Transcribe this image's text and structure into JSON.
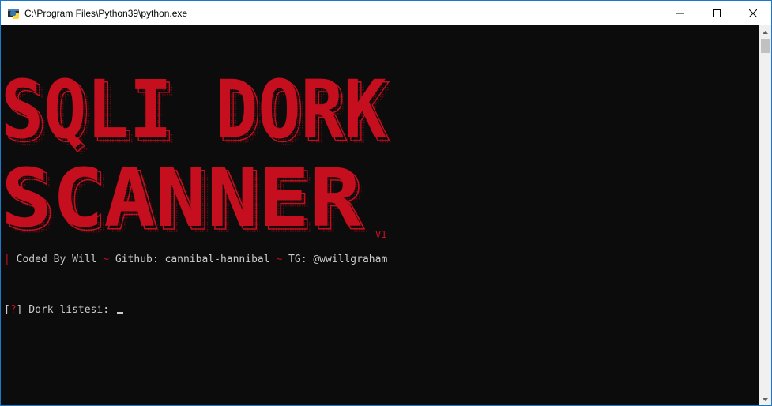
{
  "window": {
    "title": "C:\\Program Files\\Python39\\python.exe",
    "icon": "python-icon",
    "controls": [
      "minimize-icon",
      "maximize-icon",
      "close-icon"
    ]
  },
  "banner": {
    "line1": "SQLI DORK",
    "line2": "SCANNER",
    "version": "V1",
    "color": "#c50f1f"
  },
  "credits": {
    "bar": "|",
    "coded_by": " Coded By Will ",
    "sep1": "~",
    "github": " Github: cannibal-hannibal ",
    "sep2": "~",
    "tg": " TG: @wwillgraham"
  },
  "prompt": {
    "open": "[",
    "mark": "?",
    "close": "]",
    "label": " Dork listesi: "
  },
  "colors": {
    "console_bg": "#0c0c0c",
    "text": "#cccccc",
    "accent_red": "#c50f1f"
  }
}
